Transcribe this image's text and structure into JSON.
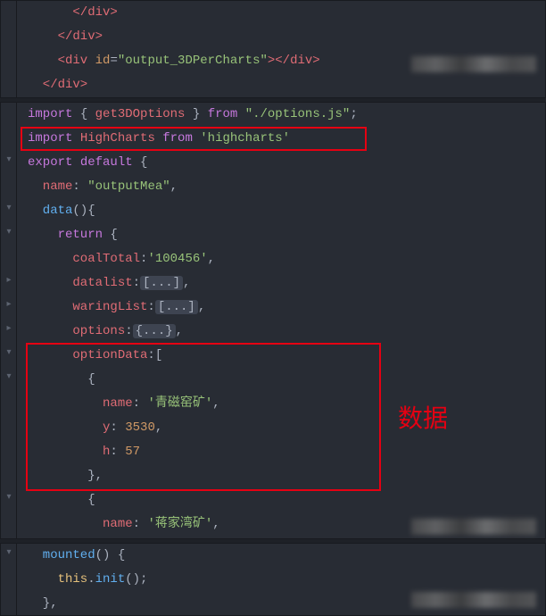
{
  "panel1": {
    "line1": "      </div>",
    "line2": "    </div>",
    "line3_open": "    <div ",
    "line3_attr": "id",
    "line3_eq": "=",
    "line3_val": "\"output_3DPerCharts\"",
    "line3_close": "></div>",
    "line4": "  </div>"
  },
  "panel2": {
    "l1_import": "import",
    "l1_brace_o": " { ",
    "l1_name": "get3DOptions",
    "l1_brace_c": " } ",
    "l1_from": "from",
    "l1_sp": " ",
    "l1_path": "\"./options.js\"",
    "l1_semi": ";",
    "l2_import": "import",
    "l2_sp1": " ",
    "l2_name": "HighCharts",
    "l2_sp2": " ",
    "l2_from": "from",
    "l2_sp3": " ",
    "l2_path": "'highcharts'",
    "l3_export": "export",
    "l3_sp": " ",
    "l3_default": "default",
    "l3_brace": " {",
    "l4_name": "  name",
    "l4_colon": ": ",
    "l4_val": "\"outputMea\"",
    "l4_comma": ",",
    "l5_data": "  data",
    "l5_paren": "(){",
    "l6_return": "    return",
    "l6_brace": " {",
    "l7_prop": "      coalTotal",
    "l7_colon": ":",
    "l7_val": "'100456'",
    "l7_comma": ",",
    "l8_prop": "      datalist",
    "l8_colon": ":",
    "l8_collapsed": "[...]",
    "l8_comma": ",",
    "l9_prop": "      waringList",
    "l9_colon": ":",
    "l9_collapsed": "[...]",
    "l9_comma": ",",
    "l10_prop": "      options",
    "l10_colon": ":",
    "l10_collapsed": "{...}",
    "l10_comma": ",",
    "l11_prop": "      optionData",
    "l11_colon": ":[",
    "l12_brace": "        {",
    "l13_prop": "          name",
    "l13_colon": ": ",
    "l13_val": "'青磁窑矿'",
    "l13_comma": ",",
    "l14_prop": "          y",
    "l14_colon": ": ",
    "l14_val": "3530",
    "l14_comma": ",",
    "l15_prop": "          h",
    "l15_colon": ": ",
    "l15_val": "57",
    "l16_brace": "        },",
    "l17_brace": "        {",
    "l18_prop": "          name",
    "l18_colon": ": ",
    "l18_val": "'蒋家湾矿'",
    "l18_comma": ","
  },
  "panel3": {
    "l1_func": "  mounted",
    "l1_paren": "() {",
    "l2_this": "    this",
    "l2_dot": ".",
    "l2_init": "init",
    "l2_paren": "();",
    "l3_brace": "  },"
  },
  "annotation": "数据"
}
